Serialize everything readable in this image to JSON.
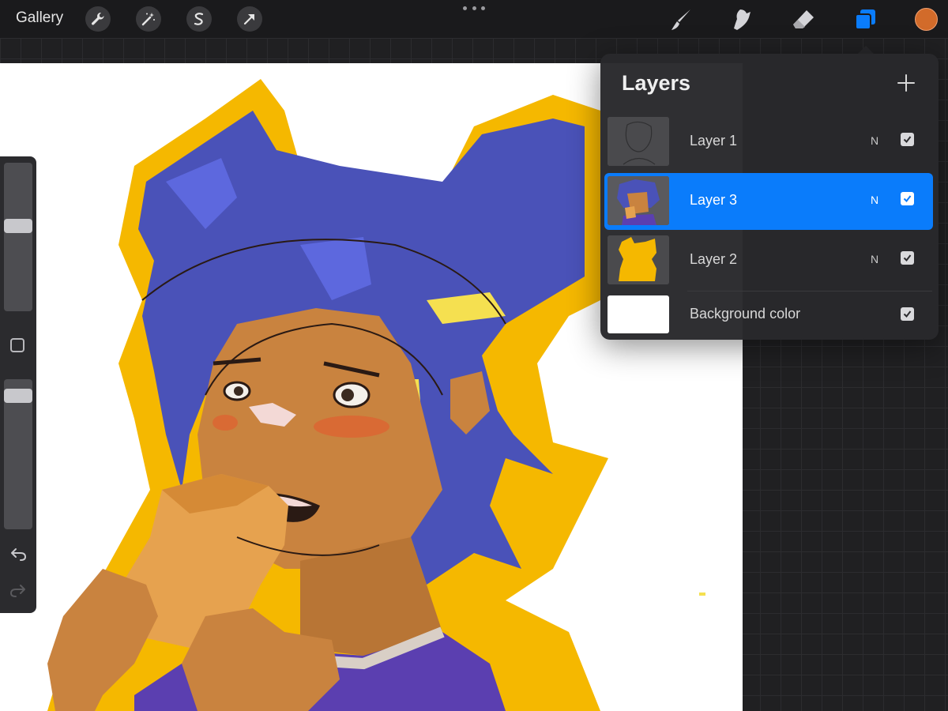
{
  "toolbar": {
    "gallery_label": "Gallery",
    "left_tools": [
      "wrench-icon",
      "magic-wand-icon",
      "selection-icon",
      "transform-arrow-icon"
    ],
    "right_tools": [
      "brush-icon",
      "smudge-icon",
      "eraser-icon",
      "layers-icon"
    ],
    "active_tool": "layers",
    "current_color": "#d26b2a",
    "accent_color": "#0a7cfb"
  },
  "sidebar": {
    "brush_size_level": 0.58,
    "opacity_level": 0.07,
    "icons": [
      "undo-icon",
      "redo-icon"
    ]
  },
  "layers_panel": {
    "title": "Layers",
    "layers": [
      {
        "name": "Layer 1",
        "blend_mode": "N",
        "visible": true,
        "active": false
      },
      {
        "name": "Layer 3",
        "blend_mode": "N",
        "visible": true,
        "active": true
      },
      {
        "name": "Layer 2",
        "blend_mode": "N",
        "visible": true,
        "active": false
      },
      {
        "name": "Background color",
        "blend_mode": "",
        "visible": true,
        "active": false
      }
    ]
  },
  "colors": {
    "hair": "#4a52b8",
    "hair_outline": "#f5b800",
    "skin": "#c9833f",
    "shirt": "#5b3fb0",
    "toast": "#e6a24f"
  }
}
